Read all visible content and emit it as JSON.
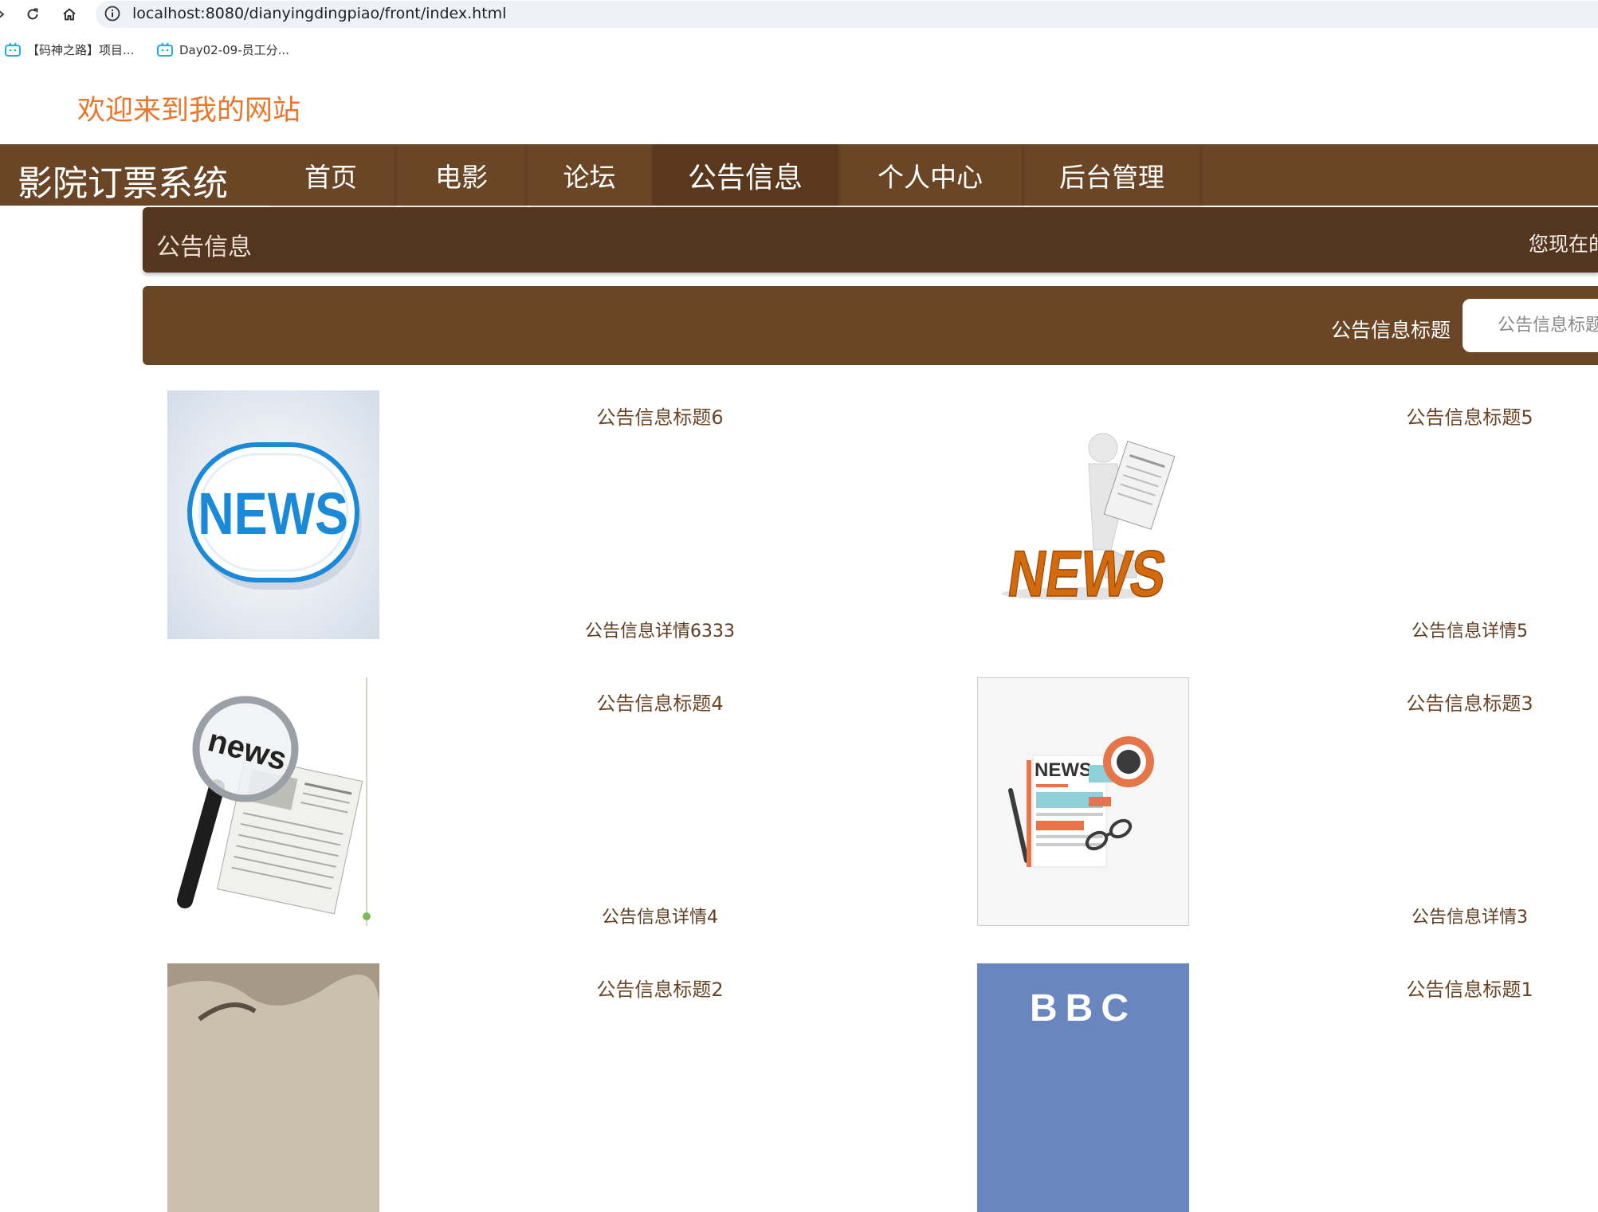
{
  "browser": {
    "url": "localhost:8080/dianyingdingpiao/front/index.html",
    "bookmarks": [
      {
        "label": "【码神之路】项目..."
      },
      {
        "label": "Day02-09-员工分..."
      }
    ]
  },
  "header": {
    "welcome": "欢迎来到我的网站"
  },
  "nav": {
    "brand": "影院订票系统",
    "items": [
      {
        "label": "首页"
      },
      {
        "label": "电影"
      },
      {
        "label": "论坛"
      },
      {
        "label": "公告信息"
      },
      {
        "label": "个人中心"
      },
      {
        "label": "后台管理"
      }
    ],
    "active_index": 3
  },
  "breadcrumb": {
    "title": "公告信息",
    "location_prefix": "您现在的"
  },
  "search": {
    "label": "公告信息标题",
    "placeholder": "公告信息标题"
  },
  "notices": [
    {
      "title": "公告信息标题6",
      "detail": "公告信息详情6333",
      "image": "news-button-icon"
    },
    {
      "title": "公告信息标题5",
      "detail": "公告信息详情5",
      "image": "figure-reading-news-icon"
    },
    {
      "title": "公告信息标题4",
      "detail": "公告信息详情4",
      "image": "magnifier-newspaper-icon"
    },
    {
      "title": "公告信息标题3",
      "detail": "公告信息详情3",
      "image": "flat-news-illustration-icon"
    },
    {
      "title": "公告信息标题2",
      "detail": "",
      "image": "newspaper-photo-icon"
    },
    {
      "title": "公告信息标题1",
      "detail": "",
      "image": "bbc-logo-icon"
    }
  ],
  "image_text": {
    "news_word": "NEWS",
    "news_lower": "news",
    "bbc": "BBC"
  },
  "colors": {
    "nav_bg": "#6b4626",
    "nav_active": "#5a381d",
    "crumb_bg": "#533520",
    "welcome": "#e9772b",
    "news_blue": "#1a8ad8",
    "news_orange": "#d46a0e"
  }
}
